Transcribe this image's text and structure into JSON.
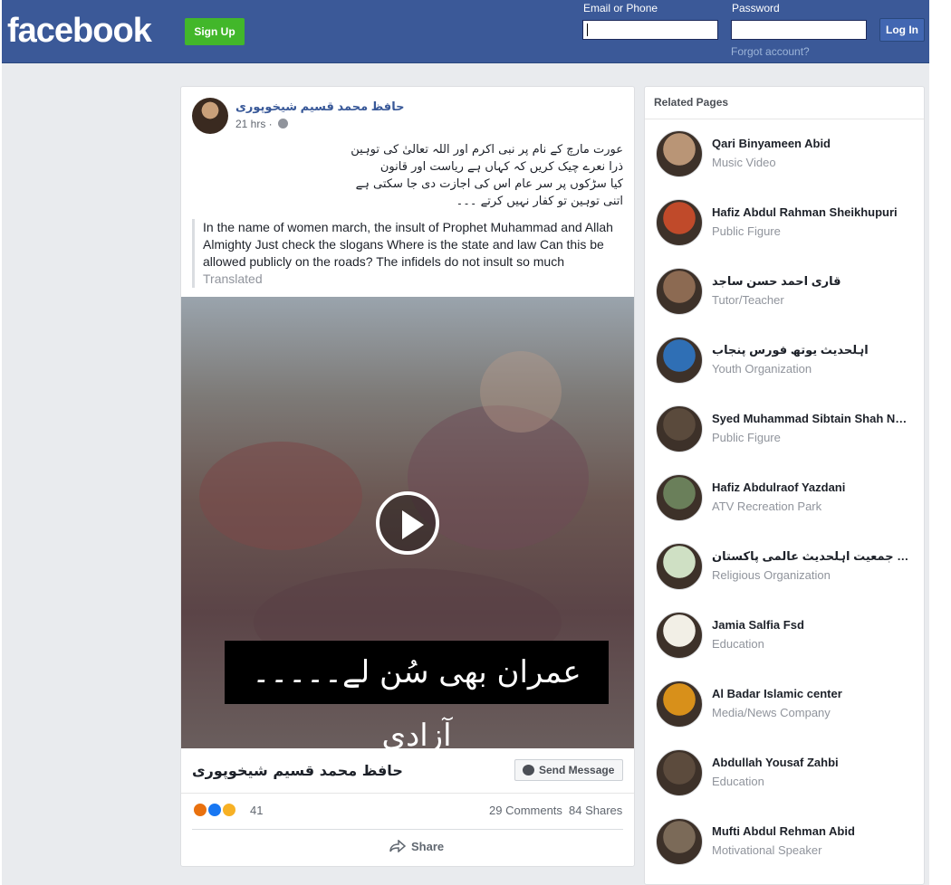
{
  "header": {
    "logo": "facebook",
    "signup_label": "Sign Up",
    "email_label": "Email or Phone",
    "password_label": "Password",
    "login_label": "Log In",
    "forgot_label": "Forgot account?",
    "brand_color": "#3b5998"
  },
  "post": {
    "author": "حافظ محمد قسیم شیخوپوری",
    "time": "21 hrs · ",
    "urdu_lines": [
      "عورت مارچ کے نام پر نبی اکرم اور اللہ تعالیٰ کی توہین",
      "ذرا نعرے چیک کریں کہ کہاں ہے ریاست اور قانون",
      "کیا سڑکوں پر سر عام اس کی اجازت دی جا سکتی ہے",
      "اتنی توہین تو کفار نہیں کرتے ۔۔۔"
    ],
    "translation": "In the name of women march, the insult of Prophet Muhammad and Allah Almighty Just check the slogans Where is the state and law Can this be allowed publicly on the roads? The infidels do not insult so much",
    "translated_label": "Translated",
    "video_caption": "عمران بھی سُن لے۔۔۔۔۔آزادی",
    "page_name": "حافظ محمد قسیم شیخوپوری",
    "send_message_label": "Send Message",
    "reaction_count": "41",
    "comments": "29 Comments",
    "shares": "84 Shares",
    "share_label": "Share"
  },
  "related": {
    "title": "Related Pages",
    "items": [
      {
        "name": "Qari Binyameen Abid",
        "category": "Music Video",
        "color": "#b99576"
      },
      {
        "name": "Hafiz Abdul Rahman Sheikhupuri",
        "category": "Public Figure",
        "color": "#c04a2a"
      },
      {
        "name": "قاری احمد حسن ساجد",
        "category": "Tutor/Teacher",
        "color": "#8c6a52"
      },
      {
        "name": "اہلحدیث یوتھ فورس پنجاب",
        "category": "Youth Organization",
        "color": "#2f6fb5"
      },
      {
        "name": "Syed Muhammad Sibtain Shah Naqvi",
        "category": "Public Figure",
        "color": "#5a4a3c"
      },
      {
        "name": "Hafiz Abdulraof Yazdani",
        "category": "ATV Recreation Park",
        "color": "#6a7f5a"
      },
      {
        "name": "مرکزی جمعیت اہلحدیث عالمی پاکستان",
        "category": "Religious Organization",
        "color": "#cfe0c4"
      },
      {
        "name": "Jamia Salfia Fsd",
        "category": "Education",
        "color": "#f2efe6"
      },
      {
        "name": "Al Badar Islamic center",
        "category": "Media/News Company",
        "color": "#d8901a"
      },
      {
        "name": "Abdullah Yousaf Zahbi",
        "category": "Education",
        "color": "#5c4b3d"
      },
      {
        "name": "Mufti Abdul Rehman Abid",
        "category": "Motivational Speaker",
        "color": "#7b6a58"
      }
    ]
  }
}
